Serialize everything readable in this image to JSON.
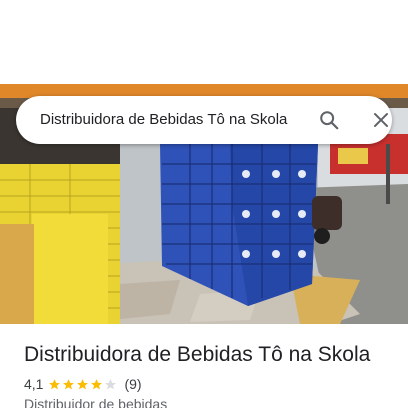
{
  "search": {
    "query": "Distribuidora de Bebidas Tô na Skola",
    "search_icon": "search-icon",
    "close_icon": "close-icon"
  },
  "place": {
    "name": "Distribuidora de Bebidas Tô na Skola",
    "rating": "4,1",
    "rating_stars_value": 4.1,
    "review_count": "(9)",
    "category": "Distribuidor de bebidas"
  },
  "colors": {
    "star_filled": "#fbbc04",
    "star_empty": "#dadce0",
    "icon_gray": "#5f6368"
  }
}
